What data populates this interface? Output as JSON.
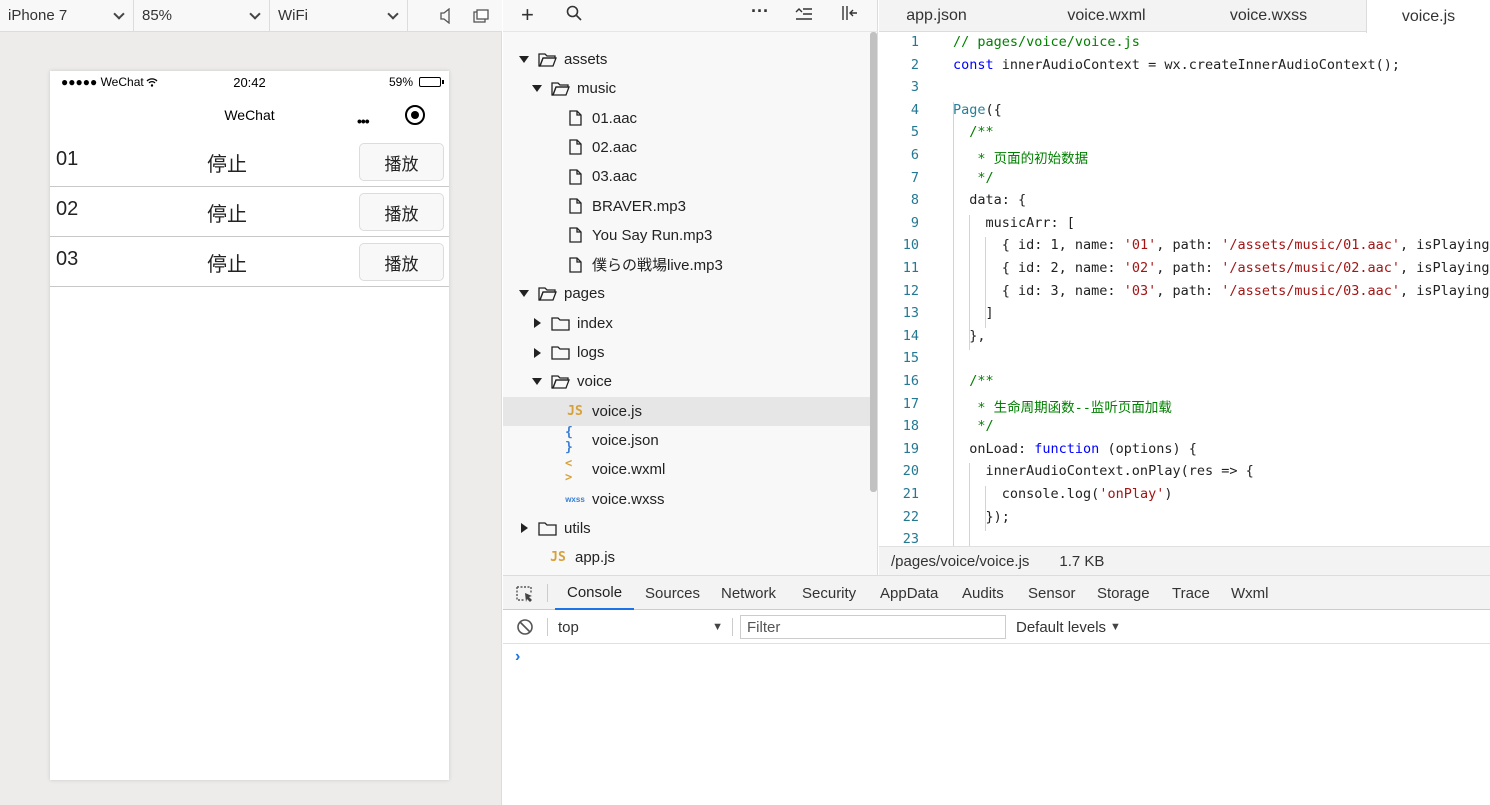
{
  "simulator": {
    "device": "iPhone 7",
    "zoom": "85%",
    "network": "WiFi",
    "statusbar": {
      "signal": "●●●●● WeChat",
      "time": "20:42",
      "battery": "59%",
      "battery_level": 0.59
    },
    "navbar_title": "WeChat",
    "nav_more": "•••",
    "rows": [
      {
        "name": "01",
        "state": "停止",
        "button": "播放"
      },
      {
        "name": "02",
        "state": "停止",
        "button": "播放"
      },
      {
        "name": "03",
        "state": "停止",
        "button": "播放"
      }
    ]
  },
  "tree": {
    "items": [
      {
        "label": "assets",
        "kind": "folder",
        "arrow": "down"
      },
      {
        "label": "music",
        "kind": "folder",
        "arrow": "down"
      },
      {
        "label": "01.aac",
        "kind": "file"
      },
      {
        "label": "02.aac",
        "kind": "file"
      },
      {
        "label": "03.aac",
        "kind": "file"
      },
      {
        "label": "BRAVER.mp3",
        "kind": "file"
      },
      {
        "label": "You Say Run.mp3",
        "kind": "file"
      },
      {
        "label": "僕らの戦場live.mp3",
        "kind": "file"
      },
      {
        "label": "pages",
        "kind": "folder",
        "arrow": "down"
      },
      {
        "label": "index",
        "kind": "folder",
        "arrow": "right"
      },
      {
        "label": "logs",
        "kind": "folder",
        "arrow": "right"
      },
      {
        "label": "voice",
        "kind": "folder",
        "arrow": "down"
      },
      {
        "label": "voice.js",
        "kind": "js",
        "icon_text": "JS"
      },
      {
        "label": "voice.json",
        "kind": "json",
        "icon_text": "{ }"
      },
      {
        "label": "voice.wxml",
        "kind": "wxml",
        "icon_text": "< >"
      },
      {
        "label": "voice.wxss",
        "kind": "wxss",
        "icon_text": "wxss"
      },
      {
        "label": "utils",
        "kind": "folder",
        "arrow": "right"
      },
      {
        "label": "app.js",
        "kind": "js",
        "icon_text": "JS"
      }
    ]
  },
  "editor": {
    "tabs": [
      "app.json",
      "voice.wxml",
      "voice.wxss",
      "voice.js"
    ],
    "active_tab": "voice.js",
    "lines": [
      "// pages/voice/voice.js",
      "const innerAudioContext = wx.createInnerAudioContext();",
      "",
      "Page({",
      "  /**",
      "   * 页面的初始数据",
      "   */",
      "  data: {",
      "    musicArr: [",
      "      { id: 1, name: '01', path: '/assets/music/01.aac', isPlaying",
      "      { id: 2, name: '02', path: '/assets/music/02.aac', isPlaying",
      "      { id: 3, name: '03', path: '/assets/music/03.aac', isPlaying",
      "    ]",
      "  },",
      "",
      "  /**",
      "   * 生命周期函数--监听页面加载",
      "   */",
      "  onLoad: function (options) {",
      "    innerAudioContext.onPlay(res => {",
      "      console.log('onPlay')",
      "    });",
      ""
    ],
    "status_path": "/pages/voice/voice.js",
    "status_size": "1.7 KB"
  },
  "devtools": {
    "tabs": [
      "Console",
      "Sources",
      "Network",
      "Security",
      "AppData",
      "Audits",
      "Sensor",
      "Storage",
      "Trace",
      "Wxml"
    ],
    "active_tab": "Console",
    "context": "top",
    "filter_placeholder": "Filter",
    "levels": "Default levels",
    "prompt": "›"
  },
  "colors": {
    "accent": "#1a73e8",
    "comment": "#008000",
    "keyword": "#0000ff",
    "string": "#a31515",
    "line_number": "#237893"
  }
}
